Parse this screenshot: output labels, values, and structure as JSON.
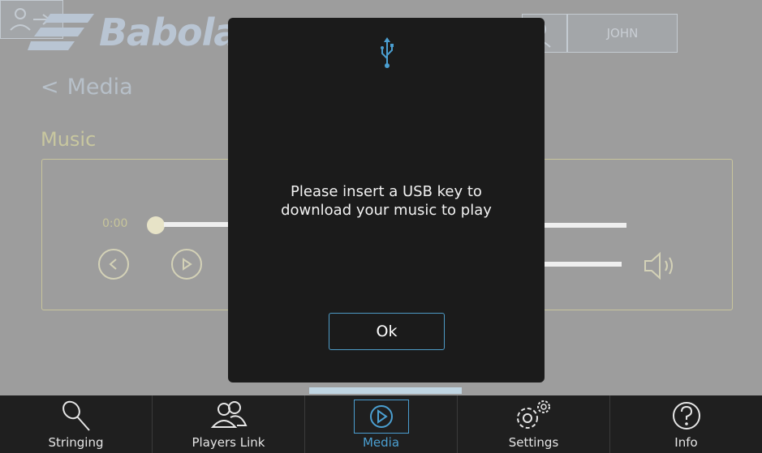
{
  "header": {
    "brand": "Babolat",
    "user_name": "JOHN"
  },
  "page": {
    "back_label": "Media",
    "section_title": "Music",
    "time_label": "0:00"
  },
  "modal": {
    "message_line1": "Please insert a USB key to",
    "message_line2": "download your music to play",
    "ok_label": "Ok"
  },
  "tabs": [
    {
      "label": "Stringing",
      "icon": "racket-icon",
      "active": false
    },
    {
      "label": "Players Link",
      "icon": "players-icon",
      "active": false
    },
    {
      "label": "Media",
      "icon": "play-icon",
      "active": true
    },
    {
      "label": "Settings",
      "icon": "gears-icon",
      "active": false
    },
    {
      "label": "Info",
      "icon": "help-icon",
      "active": false
    }
  ],
  "colors": {
    "accent": "#4b9fd1",
    "modal_bg": "#1b1b1b",
    "tabbar_bg": "#1f1f1f"
  }
}
